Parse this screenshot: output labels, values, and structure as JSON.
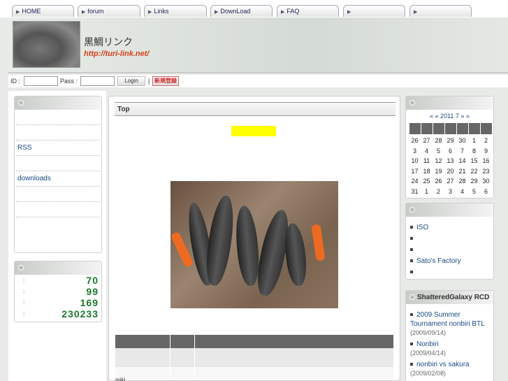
{
  "nav": {
    "tabs": [
      {
        "label": "HOME"
      },
      {
        "label": "forum"
      },
      {
        "label": "Links"
      },
      {
        "label": "DownLoad"
      },
      {
        "label": "FAQ"
      },
      {
        "label": ""
      },
      {
        "label": ""
      }
    ]
  },
  "banner": {
    "title": "黒鯛リンク",
    "url": "http://turi-link.net/"
  },
  "login": {
    "id_label": "ID :",
    "pass_label": "Pass :",
    "login_button": "Login",
    "separator": "|",
    "register_button": "新規登録"
  },
  "left_menu": {
    "items": [
      "",
      "",
      "RSS",
      "",
      "downloads",
      "",
      "",
      ""
    ]
  },
  "counter": {
    "rows": [
      {
        "label": ":",
        "value": "70"
      },
      {
        "label": ":",
        "value": "99"
      },
      {
        "label": ":",
        "value": "169"
      },
      {
        "label": ":",
        "value": "230233"
      }
    ]
  },
  "main": {
    "title": "Top",
    "table_text": "miki"
  },
  "calendar": {
    "nav": "« « 2011 7 » »",
    "days": [
      "26",
      "27",
      "28",
      "29",
      "30",
      "1",
      "2",
      "3",
      "4",
      "5",
      "6",
      "7",
      "8",
      "9",
      "10",
      "11",
      "12",
      "13",
      "14",
      "15",
      "16",
      "17",
      "18",
      "19",
      "20",
      "21",
      "22",
      "23",
      "24",
      "25",
      "26",
      "27",
      "28",
      "29",
      "30",
      "31",
      "1",
      "2",
      "3",
      "4",
      "5",
      "6"
    ]
  },
  "links": {
    "items": [
      "ISO",
      "",
      "",
      "Sato's Factory",
      ""
    ]
  },
  "rcd": {
    "title": "ShatteredGalaxy RCD",
    "items": [
      {
        "title": "2009 Summer Tournament nonbiri BTL",
        "date": "(2009/09/14)"
      },
      {
        "title": "Nonbiri",
        "date": "(2009/04/14)"
      },
      {
        "title": "nonbiri vs sakura",
        "date": "(2009/02/08)"
      }
    ]
  },
  "colors": {
    "counter_green": "#1a7a2a",
    "url_orange": "#d4401a",
    "link_blue": "#1a4a8a",
    "highlight_yellow": "#ffff00"
  }
}
